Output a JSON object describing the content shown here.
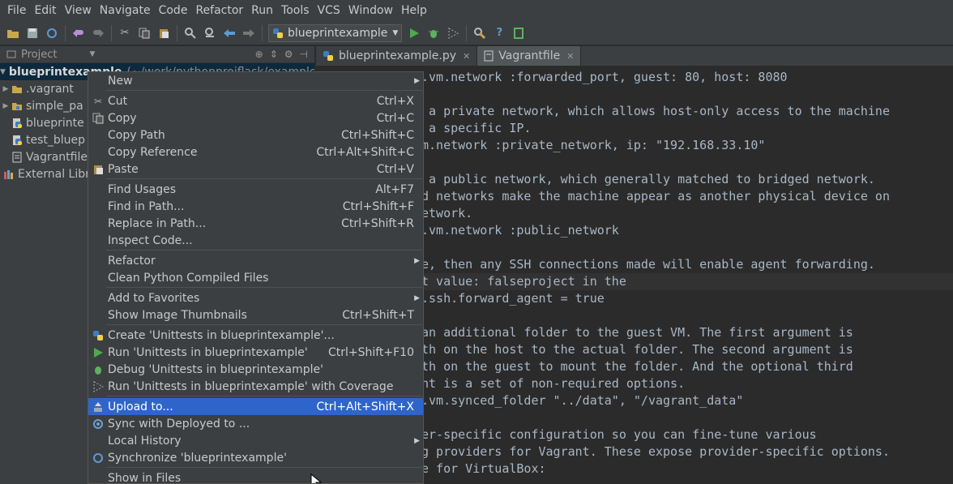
{
  "menubar": [
    "File",
    "Edit",
    "View",
    "Navigate",
    "Code",
    "Refactor",
    "Run",
    "Tools",
    "VCS",
    "Window",
    "Help"
  ],
  "toolbar": {
    "run_config": "blueprintexample"
  },
  "project_panel": {
    "header": "Project",
    "root_label": "blueprintexample",
    "root_path": "(~/work/pythonprojflask/example)",
    "items": [
      ".vagrant",
      "simple_pa",
      "blueprinte",
      "test_bluep",
      "Vagrantfile",
      "External Libra"
    ]
  },
  "editor_tabs": [
    {
      "label": "blueprintexample.py"
    },
    {
      "label": "Vagrantfile"
    }
  ],
  "editor": {
    "lines": [
      ".vm.network :forwarded_port, guest: 80, host: 8080",
      "",
      " a private network, which allows host-only access to the machine",
      " a specific IP.",
      "m.network :private_network, ip: \"192.168.33.10\"",
      "",
      " a public network, which generally matched to bridged network.",
      "d networks make the machine appear as another physical device on",
      "etwork.",
      ".vm.network :public_network",
      "",
      "e, then any SSH connections made will enable agent forwarding.",
      "t value: falseproject in the",
      ".ssh.forward_agent = true",
      "",
      "an additional folder to the guest VM. The first argument is",
      "th on the host to the actual folder. The second argument is",
      "th on the guest to mount the folder. And the optional third",
      "nt is a set of non-required options.",
      ".vm.synced_folder \"../data\", \"/vagrant_data\"",
      "",
      "er-specific configuration so you can fine-tune various",
      "g providers for Vagrant. These expose provider-specific options.",
      "e for VirtualBox:"
    ]
  },
  "context_menu": {
    "items": [
      {
        "label": "New",
        "shortcut": "",
        "submenu": true,
        "icon": ""
      },
      {
        "label": "Cut",
        "shortcut": "Ctrl+X",
        "icon": "scissors-icon"
      },
      {
        "label": "Copy",
        "shortcut": "Ctrl+C",
        "icon": "copy-icon"
      },
      {
        "label": "Copy Path",
        "shortcut": "Ctrl+Shift+C",
        "icon": ""
      },
      {
        "label": "Copy Reference",
        "shortcut": "Ctrl+Alt+Shift+C",
        "icon": ""
      },
      {
        "label": "Paste",
        "shortcut": "Ctrl+V",
        "icon": "paste-icon"
      },
      {
        "label": "Find Usages",
        "shortcut": "Alt+F7",
        "icon": ""
      },
      {
        "label": "Find in Path...",
        "shortcut": "Ctrl+Shift+F",
        "icon": ""
      },
      {
        "label": "Replace in Path...",
        "shortcut": "Ctrl+Shift+R",
        "icon": ""
      },
      {
        "label": "Inspect Code...",
        "shortcut": "",
        "icon": ""
      },
      {
        "label": "Refactor",
        "shortcut": "",
        "submenu": true,
        "icon": ""
      },
      {
        "label": "Clean Python Compiled Files",
        "shortcut": "",
        "icon": ""
      },
      {
        "label": "Add to Favorites",
        "shortcut": "",
        "submenu": true,
        "icon": ""
      },
      {
        "label": "Show Image Thumbnails",
        "shortcut": "Ctrl+Shift+T",
        "icon": ""
      },
      {
        "label": "Create 'Unittests in blueprintexample'...",
        "shortcut": "",
        "icon": "python-icon"
      },
      {
        "label": "Run 'Unittests in blueprintexample'",
        "shortcut": "Ctrl+Shift+F10",
        "icon": "run-icon"
      },
      {
        "label": "Debug 'Unittests in blueprintexample'",
        "shortcut": "",
        "icon": "debug-icon"
      },
      {
        "label": "Run 'Unittests in blueprintexample' with Coverage",
        "shortcut": "",
        "icon": "coverage-icon"
      },
      {
        "label": "Upload to...",
        "shortcut": "Ctrl+Alt+Shift+X",
        "icon": "upload-icon"
      },
      {
        "label": "Sync with Deployed to ...",
        "shortcut": "",
        "icon": "sync-icon"
      },
      {
        "label": "Local History",
        "shortcut": "",
        "submenu": true,
        "icon": ""
      },
      {
        "label": "Synchronize 'blueprintexample'",
        "shortcut": "",
        "icon": "refresh-icon"
      },
      {
        "label": "Show in Files",
        "shortcut": "",
        "icon": ""
      }
    ]
  },
  "colors": {
    "highlight": "#2f65ca",
    "panel_bg": "#3c3f41",
    "editor_bg": "#2b2b2b",
    "selected_row": "#0d293e"
  }
}
